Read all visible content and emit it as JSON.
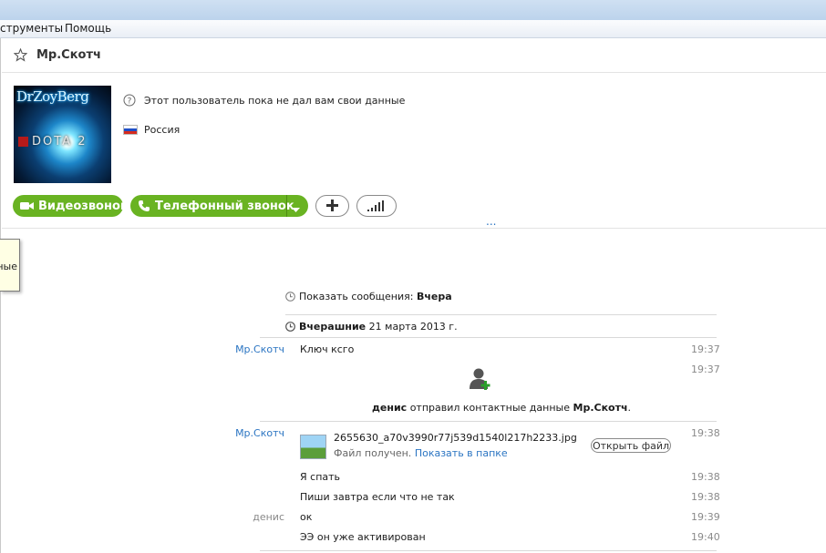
{
  "menu": {
    "tools": "струменты",
    "help": "Помощь"
  },
  "contact": {
    "name": "Мр.Скотч",
    "avatar_title": "DrZoyBerg",
    "avatar_subtitle": "DOTA 2",
    "info_text": "Этот пользователь пока не дал вам свои данные",
    "country": "Россия"
  },
  "actions": {
    "video_call": "Видеозвонок",
    "phone_call": "Телефонный звонок",
    "more": "..."
  },
  "tooltip_fragment": "ные",
  "chat": {
    "show_messages_label": "Показать сообщения:",
    "show_messages_value": "Вчера",
    "day_header_bold": "Вчерашние",
    "day_header_rest": "21 марта 2013 г.",
    "messages": [
      {
        "sender": "Мр.Скотч",
        "text": "Ключ ксго",
        "time": "19:37"
      },
      {
        "sender": "",
        "text": "",
        "time": "19:37"
      }
    ],
    "contact_share": {
      "sender": "денис",
      "middle": "отправил контактные данные",
      "contact": "Мр.Скотч",
      "end": "."
    },
    "file": {
      "sender": "Мр.Скотч",
      "time": "19:38",
      "filename": "2655630_a70v3990r77j539d1540l217h2233.jpg",
      "status": "Файл получен.",
      "show_in_folder": "Показать в папке",
      "open_button": "Открыть файл"
    },
    "later_messages": [
      {
        "sender": "",
        "text": "Я спать",
        "time": "19:38"
      },
      {
        "sender": "",
        "text": "Пиши завтра если что не так",
        "time": "19:38"
      },
      {
        "sender": "денис",
        "text": "ок",
        "time": "19:39"
      },
      {
        "sender": "",
        "text": "ЭЭ он уже активирован",
        "time": "19:40"
      }
    ]
  },
  "colors": {
    "accent_green": "#69b322",
    "link_blue": "#2a74c2"
  }
}
